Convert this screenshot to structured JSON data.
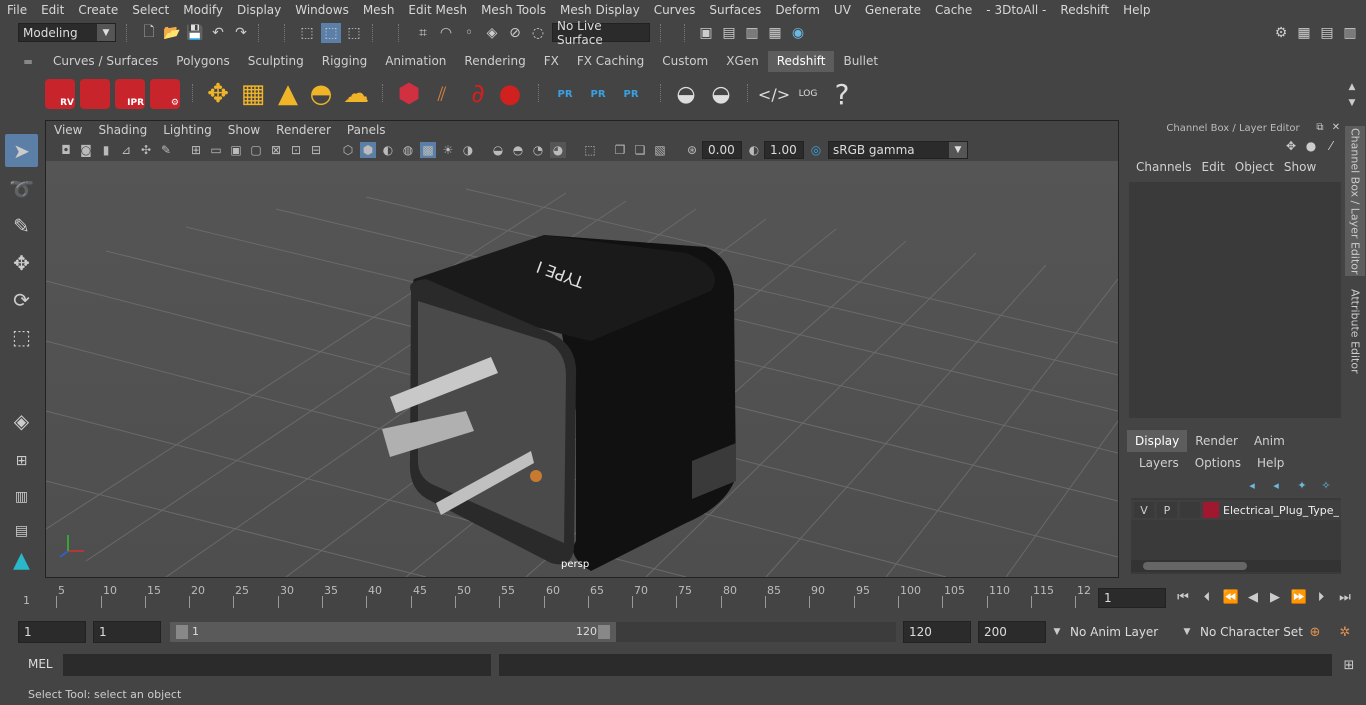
{
  "menubar": [
    "File",
    "Edit",
    "Create",
    "Select",
    "Modify",
    "Display",
    "Windows",
    "Mesh",
    "Edit Mesh",
    "Mesh Tools",
    "Mesh Display",
    "Curves",
    "Surfaces",
    "Deform",
    "UV",
    "Generate",
    "Cache",
    "- 3DtoAll -",
    "Redshift",
    "Help"
  ],
  "status": {
    "mode": "Modeling",
    "live_surface": "No Live Surface"
  },
  "shelf_tabs": [
    "Curves / Surfaces",
    "Polygons",
    "Sculpting",
    "Rigging",
    "Animation",
    "Rendering",
    "FX",
    "FX Caching",
    "Custom",
    "XGen",
    "Redshift",
    "Bullet"
  ],
  "shelf_active": "Redshift",
  "shelf_labels": {
    "rv": "RV",
    "ipr": "IPR",
    "pr": "PR",
    "log": "LOG",
    "help": "?"
  },
  "viewport": {
    "menu": [
      "View",
      "Shading",
      "Lighting",
      "Show",
      "Renderer",
      "Panels"
    ],
    "exposure": "0.00",
    "gamma": "1.00",
    "color_space": "sRGB gamma",
    "camera_label": "persp",
    "model_text": "TYPE I"
  },
  "channel_box": {
    "title": "Channel Box / Layer Editor",
    "menu": [
      "Channels",
      "Edit",
      "Object",
      "Show"
    ],
    "layer_tabs": [
      "Display",
      "Render",
      "Anim"
    ],
    "layer_menu": [
      "Layers",
      "Options",
      "Help"
    ],
    "layer": {
      "v": "V",
      "p": "P",
      "name": "Electrical_Plug_Type_I",
      "color": "#a01830"
    }
  },
  "side_tabs": [
    "Channel Box / Layer Editor",
    "Attribute Editor"
  ],
  "timeline": {
    "ticks": [
      "5",
      "10",
      "15",
      "20",
      "25",
      "30",
      "35",
      "40",
      "45",
      "50",
      "55",
      "60",
      "65",
      "70",
      "75",
      "80",
      "85",
      "90",
      "95",
      "100",
      "105",
      "110",
      "115",
      "12"
    ],
    "current_frame": "1",
    "start_marker": "1"
  },
  "range": {
    "start": "1",
    "playback_start": "1",
    "slider_start": "1",
    "slider_end": "120",
    "playback_end": "120",
    "end": "200",
    "anim_layer": "No Anim Layer",
    "char_set": "No Character Set"
  },
  "mel": {
    "label": "MEL"
  },
  "help_line": "Select Tool: select an object"
}
